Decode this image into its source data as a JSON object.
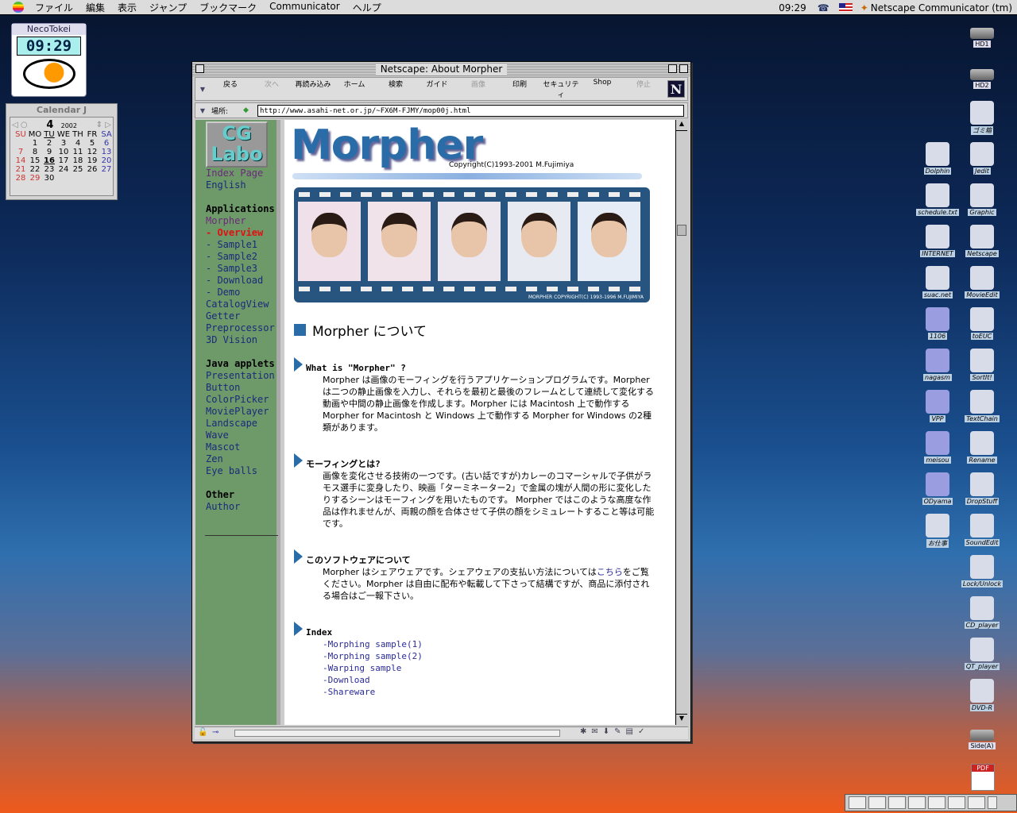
{
  "menubar": {
    "items": [
      "ファイル",
      "編集",
      "表示",
      "ジャンプ",
      "ブックマーク",
      "Communicator",
      "ヘルプ"
    ],
    "clock": "09:29",
    "app": "Netscape Communicator (tm)"
  },
  "neco": {
    "title": "NecoTokei",
    "time": "09:29"
  },
  "calendar": {
    "title": "Calendar J",
    "month": "4",
    "year": "2002",
    "weekdays": [
      "SU",
      "MO",
      "TU",
      "WE",
      "TH",
      "FR",
      "SA"
    ],
    "days": [
      "",
      "1",
      "2",
      "3",
      "4",
      "5",
      "6",
      "7",
      "8",
      "9",
      "10",
      "11",
      "12",
      "13",
      "14",
      "15",
      "16",
      "17",
      "18",
      "19",
      "20",
      "21",
      "22",
      "23",
      "24",
      "25",
      "26",
      "27",
      "28",
      "29",
      "30"
    ],
    "today": "16"
  },
  "browser": {
    "title": "Netscape: About Morpher",
    "toolbar": [
      {
        "label": "戻る",
        "enabled": true
      },
      {
        "label": "次へ",
        "enabled": false
      },
      {
        "label": "再読み込み",
        "enabled": true
      },
      {
        "label": "ホーム",
        "enabled": true
      },
      {
        "label": "検索",
        "enabled": true
      },
      {
        "label": "ガイド",
        "enabled": true
      },
      {
        "label": "画像",
        "enabled": false
      },
      {
        "label": "印刷",
        "enabled": true
      },
      {
        "label": "セキュリティ",
        "enabled": true
      },
      {
        "label": "Shop",
        "enabled": true
      },
      {
        "label": "停止",
        "enabled": false
      }
    ],
    "location_label": "場所:",
    "url": "http://www.asahi-net.or.jp/~FX6M-FJMY/mop00j.html"
  },
  "sidebar": {
    "logo": "CG Labo",
    "items": [
      {
        "t": "Index Page",
        "c": "#6a2a7a"
      },
      {
        "t": "English",
        "c": "#1a2a7a"
      },
      {
        "t": ""
      },
      {
        "t": "Applications",
        "c": "#000",
        "b": true
      },
      {
        "t": "Morpher",
        "c": "#6a2a7a"
      },
      {
        "t": "- Overview",
        "c": "#e01010",
        "b": true
      },
      {
        "t": "- Sample1",
        "c": "#1a2a7a"
      },
      {
        "t": "- Sample2",
        "c": "#1a2a7a"
      },
      {
        "t": "- Sample3",
        "c": "#1a2a7a"
      },
      {
        "t": "- Download",
        "c": "#1a2a7a"
      },
      {
        "t": "- Demo",
        "c": "#1a2a7a"
      },
      {
        "t": "CatalogView",
        "c": "#1a2a7a"
      },
      {
        "t": "Getter",
        "c": "#1a2a7a"
      },
      {
        "t": "Preprocessor",
        "c": "#1a2a7a"
      },
      {
        "t": "3D Vision",
        "c": "#1a2a7a"
      },
      {
        "t": ""
      },
      {
        "t": "Java applets",
        "c": "#000",
        "b": true
      },
      {
        "t": "Presentation",
        "c": "#1a2a7a"
      },
      {
        "t": "Button",
        "c": "#1a2a7a"
      },
      {
        "t": "ColorPicker",
        "c": "#1a2a7a"
      },
      {
        "t": "MoviePlayer",
        "c": "#1a2a7a"
      },
      {
        "t": "Landscape",
        "c": "#1a2a7a"
      },
      {
        "t": "Wave",
        "c": "#1a2a7a"
      },
      {
        "t": "Mascot",
        "c": "#1a2a7a"
      },
      {
        "t": "Zen",
        "c": "#1a2a7a"
      },
      {
        "t": "Eye balls",
        "c": "#1a2a7a"
      },
      {
        "t": ""
      },
      {
        "t": "Other",
        "c": "#000",
        "b": true
      },
      {
        "t": "Author",
        "c": "#1a2a7a"
      }
    ]
  },
  "page": {
    "logo": "Morpher",
    "copyright": "Copyright(C)1993-2001 M.Fujimiya",
    "film_caption": "MORPHER COPYRIGHT(C) 1993-1996 M.FUJIMIYA",
    "heading": "Morpher について",
    "s1": {
      "title": "What is \"Morpher\" ?",
      "body": "Morpher は画像のモーフィングを行うアプリケーションプログラムです。Morpher は二つの静止画像を入力し、それらを最初と最後のフレームとして連続して変化する動画や中間の静止画像を作成します。Morpher には Macintosh 上で動作する Morpher for Macintosh と Windows 上で動作する Morpher for Windows の2種類があります。"
    },
    "s2": {
      "title": "モーフィングとは?",
      "body": "画像を変化させる技術の一つです。(古い話ですが)カレーのコマーシャルで子供がラモス選手に変身したり、映画「ターミネーター2」で金属の塊が人間の形に変化したりするシーンはモーフィングを用いたものです。 Morpher ではこのような高度な作品は作れませんが、両親の顔を合体させて子供の顔をシミュレートすること等は可能です。"
    },
    "s3": {
      "title": "このソフトウェアについて",
      "body_a": "Morpher はシェアウェアです。シェアウェアの支払い方法については",
      "link": "こちら",
      "body_b": "をご覧ください。Morpher は自由に配布や転載して下さって結構ですが、商品に添付される場合はご一報下さい。"
    },
    "s4": {
      "title": "Index",
      "links": [
        "-Morphing sample(1)",
        "-Morphing sample(2)",
        "-Warping sample",
        "-Download",
        "-Shareware"
      ]
    }
  },
  "desktop_icons": [
    "HD1",
    "HD2",
    "ゴミ箱",
    "Dolphin",
    "Jedit",
    "schedule.txt",
    "Graphic",
    "INTERNET",
    "Netscape",
    "suac.net",
    "MovieEdit",
    "1106",
    "toEUC",
    "nagasm",
    "SortIt!",
    "VPP",
    "TextChain",
    "meisou",
    "Rename",
    "ODyama",
    "DropStuff",
    "お仕事",
    "SoundEdit",
    "Lock/Unlock",
    "CD_player",
    "QT_player",
    "DVD-R",
    "Side(A)"
  ]
}
